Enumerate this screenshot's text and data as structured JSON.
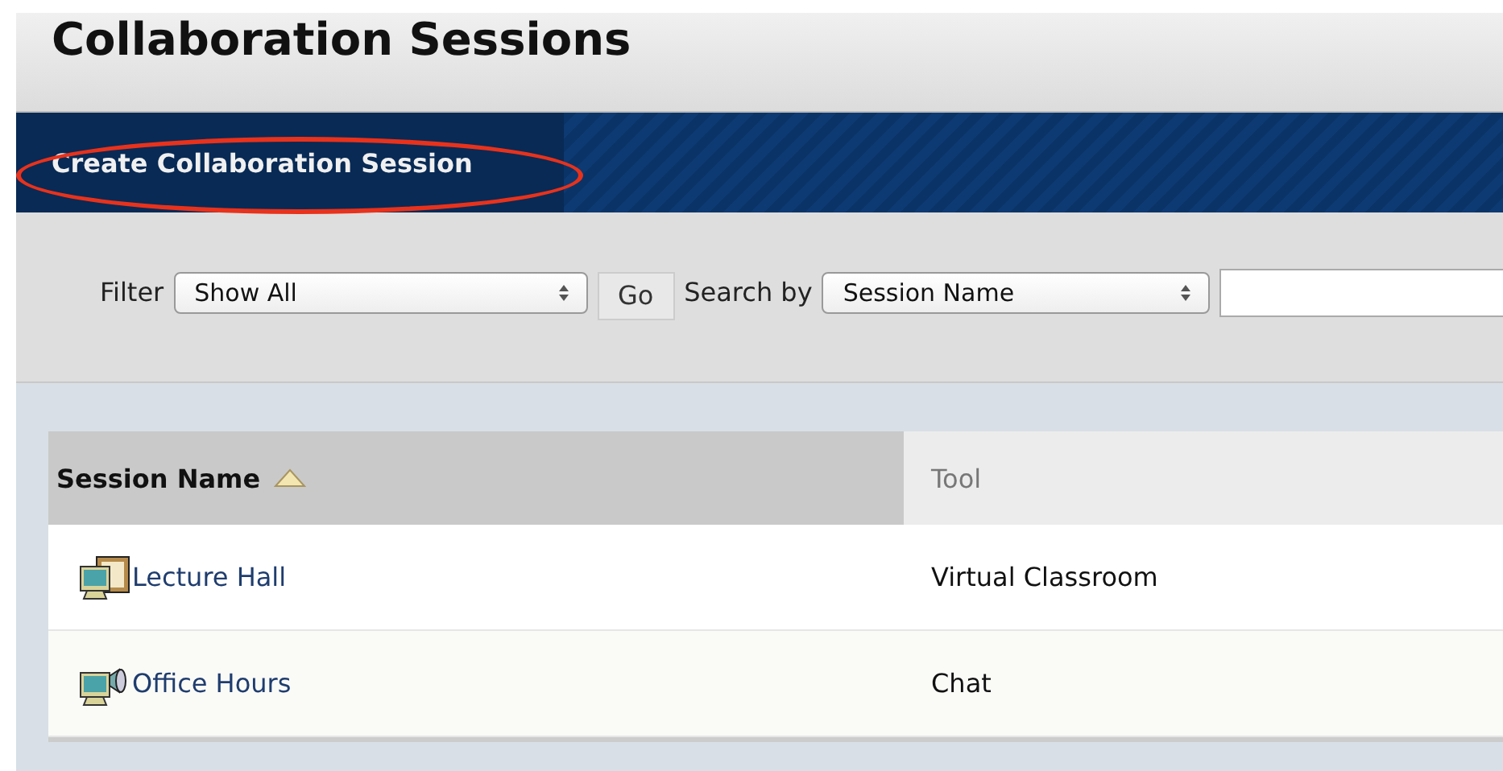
{
  "page": {
    "title": "Collaboration Sessions"
  },
  "action_bar": {
    "button": "Create Collaboration Session",
    "highlighted": true
  },
  "filter_bar": {
    "filter_label": "Filter",
    "filter_value": "Show All",
    "go_button": "Go",
    "search_label": "Search by",
    "search_by_value": "Session Name"
  },
  "table": {
    "columns": [
      {
        "label": "Session Name",
        "sorted": true
      },
      {
        "label": "Tool",
        "sorted": false
      }
    ],
    "rows": [
      {
        "kind": "classroom",
        "name": "Lecture Hall",
        "tool": "Virtual Classroom"
      },
      {
        "kind": "chat",
        "name": "Office Hours",
        "tool": "Chat"
      }
    ]
  }
}
